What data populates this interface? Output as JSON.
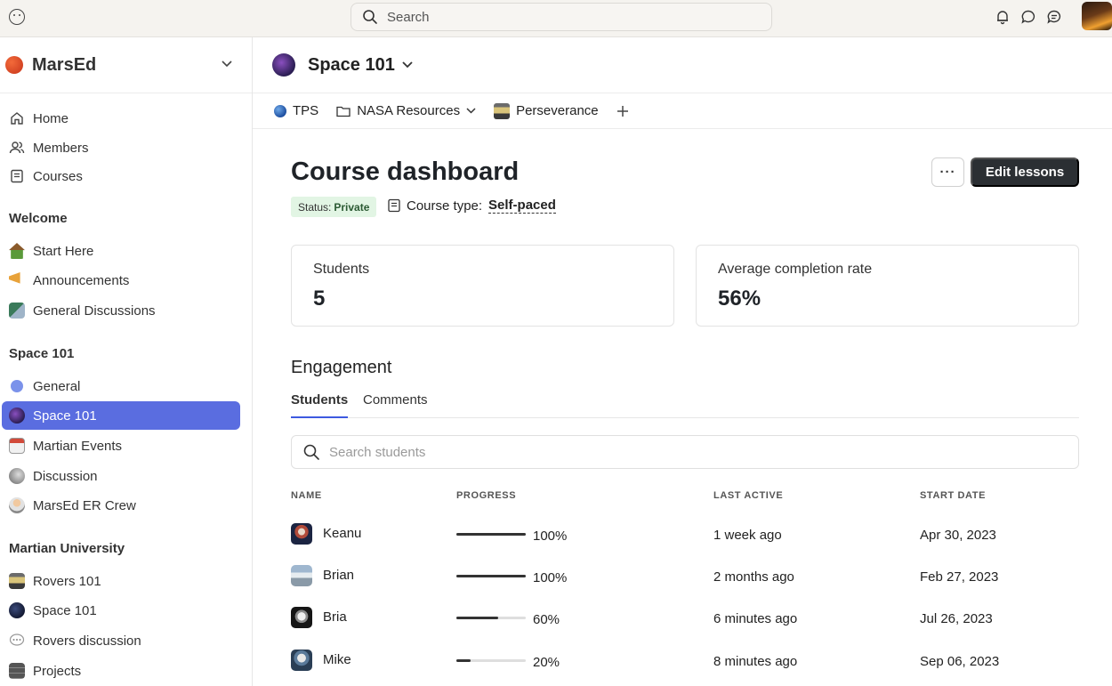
{
  "topbar": {
    "search_placeholder": "Search"
  },
  "sidebar": {
    "community_name": "MarsEd",
    "primary": [
      {
        "label": "Home"
      },
      {
        "label": "Members"
      },
      {
        "label": "Courses"
      }
    ],
    "sections": [
      {
        "title": "Welcome",
        "items": [
          {
            "label": "Start Here"
          },
          {
            "label": "Announcements"
          },
          {
            "label": "General Discussions"
          }
        ]
      },
      {
        "title": "Space 101",
        "items": [
          {
            "label": "General"
          },
          {
            "label": "Space 101"
          },
          {
            "label": "Martian Events"
          },
          {
            "label": "Discussion"
          },
          {
            "label": "MarsEd ER Crew"
          }
        ]
      },
      {
        "title": "Martian University",
        "items": [
          {
            "label": "Rovers 101"
          },
          {
            "label": "Space 101"
          },
          {
            "label": "Rovers discussion"
          },
          {
            "label": "Projects"
          }
        ]
      }
    ],
    "active_item": "Space 101"
  },
  "space": {
    "title": "Space 101",
    "tabs": [
      {
        "label": "TPS"
      },
      {
        "label": "NASA Resources"
      },
      {
        "label": "Perseverance"
      }
    ]
  },
  "dashboard": {
    "title": "Course dashboard",
    "more_label": "···",
    "edit_label": "Edit lessons",
    "status_prefix": "Status:",
    "status_value": "Private",
    "course_type_label": "Course type:",
    "course_type_value": "Self-paced",
    "stats": [
      {
        "label": "Students",
        "value": "5"
      },
      {
        "label": "Average completion rate",
        "value": "56%"
      }
    ],
    "engagement_title": "Engagement",
    "engagement_tabs": [
      {
        "label": "Students"
      },
      {
        "label": "Comments"
      }
    ],
    "search_placeholder": "Search students",
    "columns": {
      "name": "NAME",
      "progress": "PROGRESS",
      "last_active": "LAST ACTIVE",
      "start_date": "START DATE"
    },
    "rows": [
      {
        "name": "Keanu",
        "progress": 1.0,
        "progress_label": "100%",
        "last_active": "1 week ago",
        "start_date": "Apr 30, 2023"
      },
      {
        "name": "Brian",
        "progress": 1.0,
        "progress_label": "100%",
        "last_active": "2 months ago",
        "start_date": "Feb 27, 2023"
      },
      {
        "name": "Bria",
        "progress": 0.6,
        "progress_label": "60%",
        "last_active": "6 minutes ago",
        "start_date": "Jul 26, 2023"
      },
      {
        "name": "Mike",
        "progress": 0.2,
        "progress_label": "20%",
        "last_active": "8 minutes ago",
        "start_date": "Sep 06, 2023"
      }
    ]
  },
  "colors": {
    "accent": "#5a6de0",
    "primary_button": "#2b2f33",
    "status_bg": "#e2f5e4",
    "tab_underline": "#3d5ae0"
  }
}
